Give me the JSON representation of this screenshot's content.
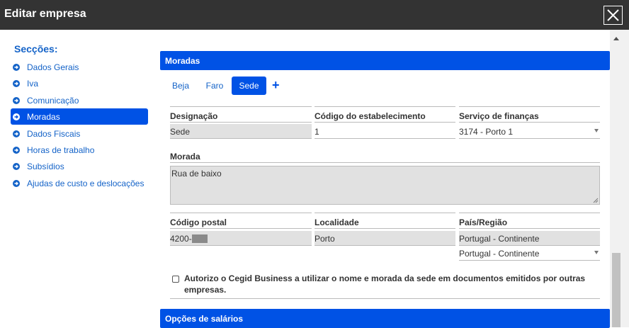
{
  "window": {
    "title": "Editar empresa"
  },
  "sidebar": {
    "heading": "Secções:",
    "items": [
      {
        "label": "Dados Gerais"
      },
      {
        "label": "Iva"
      },
      {
        "label": "Comunicação"
      },
      {
        "label": "Moradas",
        "active": true
      },
      {
        "label": "Dados Fiscais"
      },
      {
        "label": "Horas de trabalho"
      },
      {
        "label": "Subsídios"
      },
      {
        "label": "Ajudas de custo e deslocações"
      }
    ]
  },
  "sections": {
    "moradas": "Moradas",
    "opcoes_salarios": "Opções de salários"
  },
  "tabs": {
    "items": [
      "Beja",
      "Faro",
      "Sede"
    ],
    "active": "Sede",
    "add_label": "+"
  },
  "form": {
    "designacao": {
      "label": "Designação",
      "value": "Sede"
    },
    "codigo_estabelecimento": {
      "label": "Código do estabelecimento",
      "value": "1"
    },
    "servico_financas": {
      "label": "Serviço de finanças",
      "value": "3174 - Porto 1"
    },
    "morada": {
      "label": "Morada",
      "value": "Rua de baixo"
    },
    "codigo_postal": {
      "label": "Código postal",
      "value": "4200-"
    },
    "localidade": {
      "label": "Localidade",
      "value": "Porto"
    },
    "pais_regiao": {
      "label": "País/Região",
      "value": "Portugal - Continente",
      "select_value": "Portugal - Continente"
    }
  },
  "consent": {
    "checked": false,
    "label": "Autorizo o Cegid Business a utilizar o nome e morada da sede em documentos emitidos por outras empresas."
  },
  "colors": {
    "accent": "#0052e5",
    "link": "#1463c8",
    "titlebar": "#333333",
    "readonly": "#e1e1e1"
  }
}
